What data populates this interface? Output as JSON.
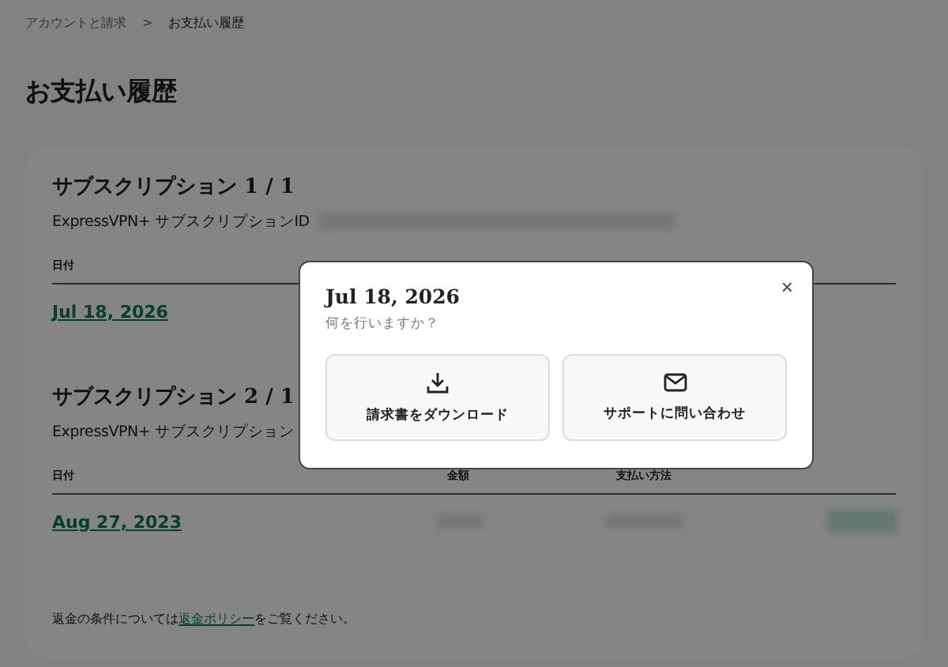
{
  "breadcrumb": {
    "items": [
      "アカウントと請求",
      "お支払い履歴"
    ],
    "separator": ">"
  },
  "title": "お支払い履歴",
  "subscriptions": [
    {
      "heading": "サブスクリプション 1 / 1",
      "id_label": "ExpressVPN+ サブスクリプションID",
      "columns": [
        "日付"
      ],
      "rows": [
        {
          "date": "Jul 18, 2026"
        }
      ]
    },
    {
      "heading": "サブスクリプション 2 / 1",
      "id_label": "ExpressVPN+ サブスクリプション",
      "columns": [
        "日付",
        "金額",
        "支払い方法"
      ],
      "rows": [
        {
          "date": "Aug 27, 2023"
        }
      ]
    }
  ],
  "footer": {
    "before": "返金の条件については",
    "link": "返金ポリシー",
    "after": "をご覧ください。"
  },
  "modal": {
    "title": "Jul 18, 2026",
    "prompt": "何を行いますか？",
    "close": "×",
    "actions": [
      {
        "kind": "download",
        "label": "請求書をダウンロード"
      },
      {
        "kind": "mail",
        "label": "サポートに問い合わせ"
      }
    ]
  }
}
